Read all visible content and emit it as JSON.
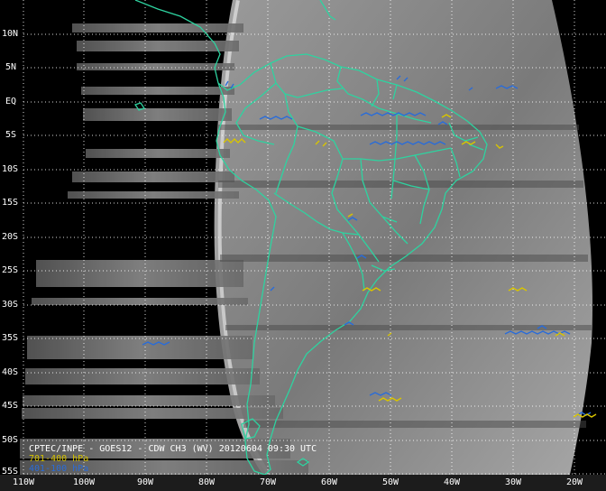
{
  "map": {
    "lat_labels": [
      "10N",
      "5N",
      "EQ",
      "5S",
      "10S",
      "15S",
      "20S",
      "25S",
      "30S",
      "35S",
      "40S",
      "45S",
      "50S",
      "55S"
    ],
    "lon_labels": [
      "110W",
      "100W",
      "90W",
      "80W",
      "70W",
      "60W",
      "50W",
      "40W",
      "30W",
      "20W"
    ],
    "caption": {
      "line1": "CPTEC/INPE - GOES12 - CDW CH3 (WV) 20120604 09:30 UTC",
      "line2": "701-400 hPa",
      "line3": "401-100 hPa"
    },
    "colors": {
      "coastline": "#2ed3a0",
      "grid": "#ffffff",
      "wind_701_400": "#d8c400",
      "wind_401_100": "#2a6cd8",
      "background": "#000000"
    }
  }
}
